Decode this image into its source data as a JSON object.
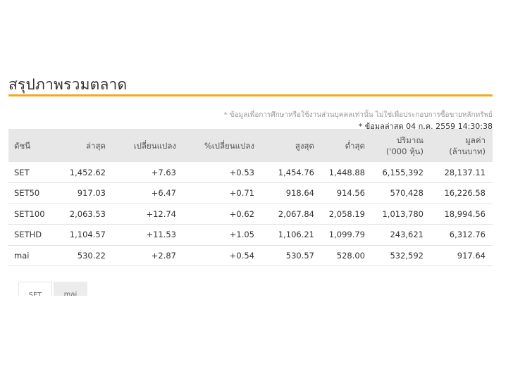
{
  "title": "สรุปภาพรวมตลาด",
  "note": "* ข้อมูลเพื่อการศึกษาหรือใช้งานส่วนบุคคลเท่านั้น ไม่ใช่เพื่อประกอบการซื้อขายหลักทรัพย์",
  "updated": "* ข้อมูลล่าสุด 04 ก.ค. 2559 14:30:38",
  "colors": {
    "accent": "#f3a81d",
    "positive": "#3a9b2a",
    "link": "#2d79c2",
    "header_bg": "#e7e7e7"
  },
  "table": {
    "headers": [
      {
        "line1": "ดัชนี",
        "line2": ""
      },
      {
        "line1": "ล่าสุด",
        "line2": ""
      },
      {
        "line1": "เปลี่ยนแปลง",
        "line2": ""
      },
      {
        "line1": "%เปลี่ยนแปลง",
        "line2": ""
      },
      {
        "line1": "สูงสุด",
        "line2": ""
      },
      {
        "line1": "ต่ำสุด",
        "line2": ""
      },
      {
        "line1": "ปริมาณ",
        "line2": "('000 หุ้น)"
      },
      {
        "line1": "มูลค่า",
        "line2": "(ล้านบาท)"
      }
    ],
    "rows": [
      {
        "index": "SET",
        "link": false,
        "last": "1,452.62",
        "change": "+7.63",
        "pct": "+0.53",
        "high": "1,454.76",
        "low": "1,448.88",
        "volume": "6,155,392",
        "value": "28,137.11"
      },
      {
        "index": "SET50",
        "link": true,
        "last": "917.03",
        "change": "+6.47",
        "pct": "+0.71",
        "high": "918.64",
        "low": "914.56",
        "volume": "570,428",
        "value": "16,226.58"
      },
      {
        "index": "SET100",
        "link": true,
        "last": "2,063.53",
        "change": "+12.74",
        "pct": "+0.62",
        "high": "2,067.84",
        "low": "2,058.19",
        "volume": "1,013,780",
        "value": "18,994.56"
      },
      {
        "index": "SETHD",
        "link": true,
        "last": "1,104.57",
        "change": "+11.53",
        "pct": "+1.05",
        "high": "1,106.21",
        "low": "1,099.79",
        "volume": "243,621",
        "value": "6,312.76"
      },
      {
        "index": "mai",
        "link": false,
        "last": "530.22",
        "change": "+2.87",
        "pct": "+0.54",
        "high": "530.57",
        "low": "528.00",
        "volume": "532,592",
        "value": "917.64"
      }
    ]
  },
  "tabs": [
    {
      "label": "SET"
    },
    {
      "label": "mai"
    }
  ]
}
